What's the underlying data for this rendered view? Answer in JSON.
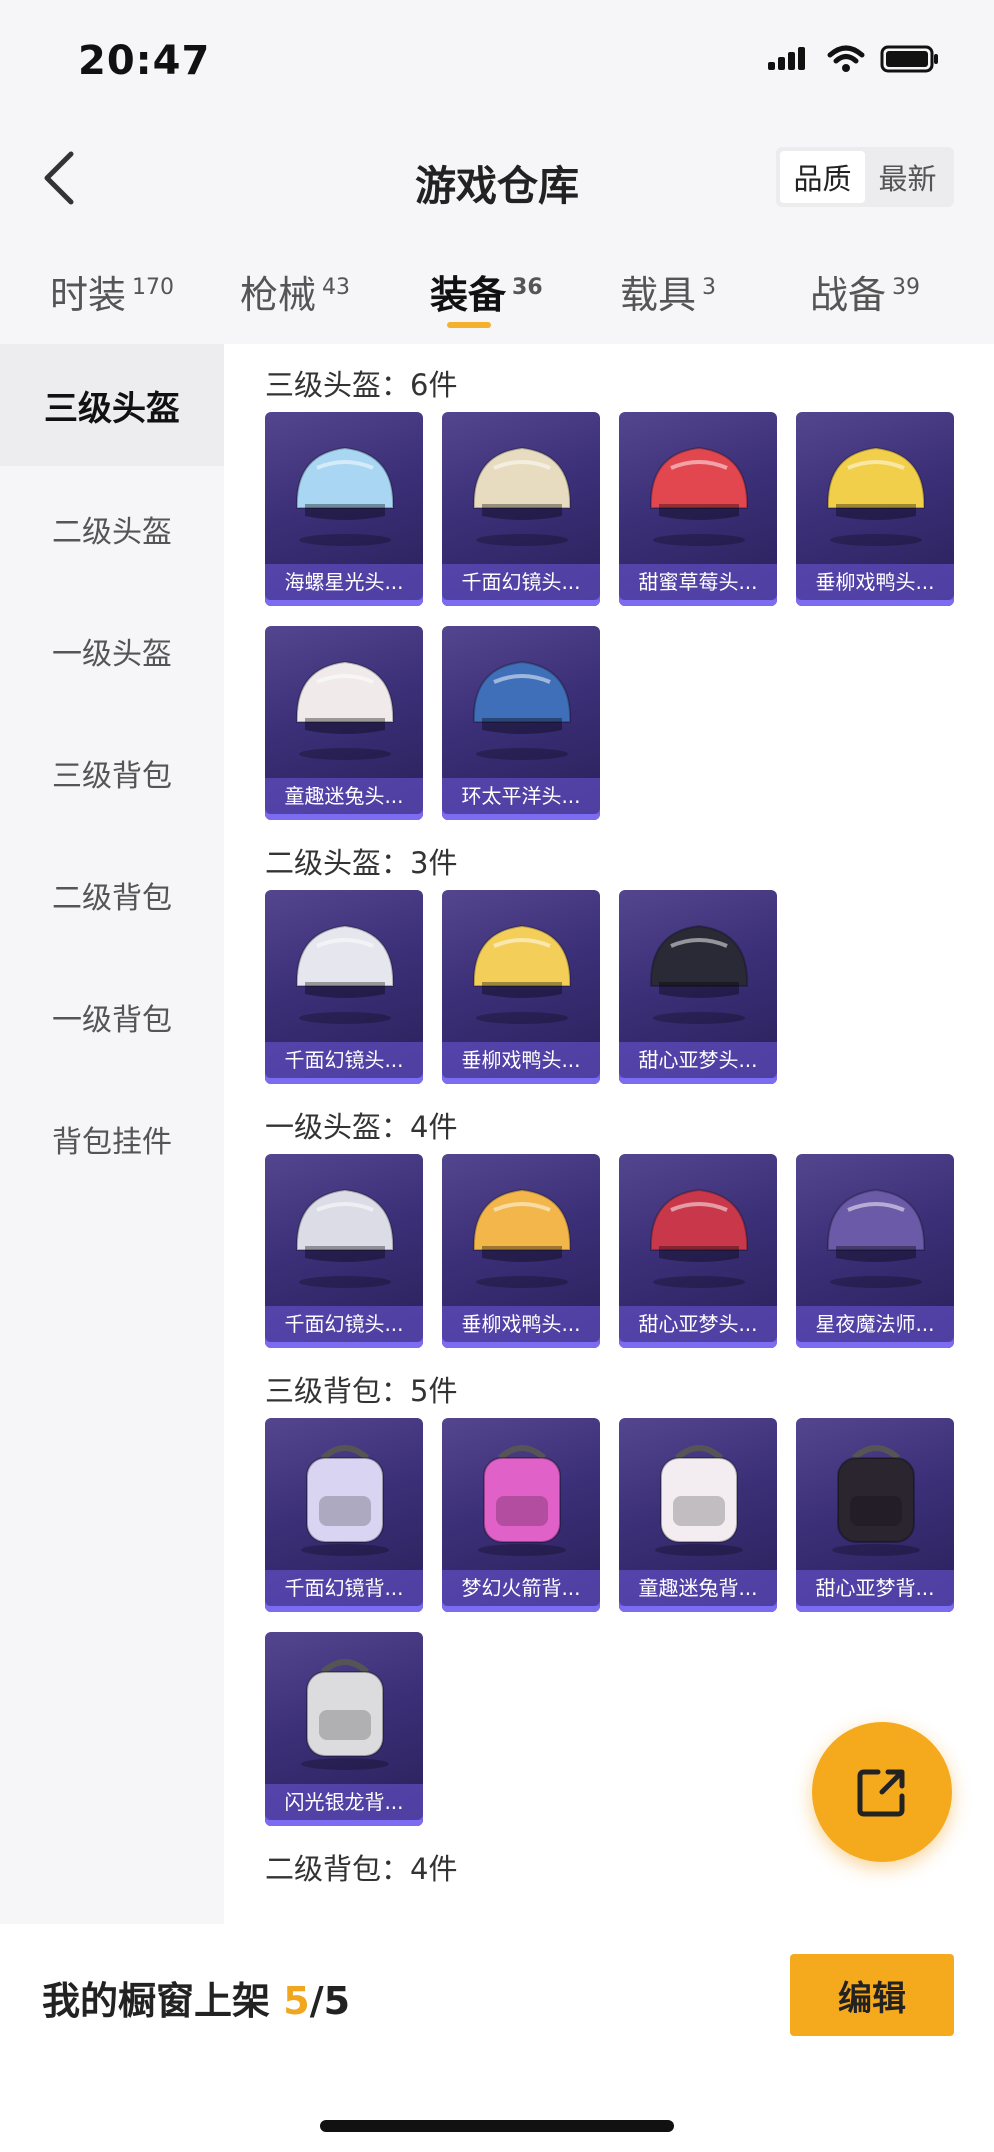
{
  "status": {
    "time": "20:47"
  },
  "header": {
    "title": "游戏仓库",
    "sort_options": [
      "品质",
      "最新"
    ],
    "sort_active": "品质"
  },
  "tabs": [
    {
      "label": "时装",
      "count": "170"
    },
    {
      "label": "枪械",
      "count": "43"
    },
    {
      "label": "装备",
      "count": "36",
      "active": true
    },
    {
      "label": "载具",
      "count": "3"
    },
    {
      "label": "战备",
      "count": "39"
    }
  ],
  "sidebar": [
    {
      "label": "三级头盔",
      "active": true
    },
    {
      "label": "二级头盔"
    },
    {
      "label": "一级头盔"
    },
    {
      "label": "三级背包"
    },
    {
      "label": "二级背包"
    },
    {
      "label": "一级背包"
    },
    {
      "label": "背包挂件"
    }
  ],
  "groups": [
    {
      "title": "三级头盔：6件",
      "items": [
        {
          "name": "海螺星光头...",
          "icon": "helmet-icon",
          "color": "#a9d6f2"
        },
        {
          "name": "千面幻镜头...",
          "icon": "helmet-icon",
          "color": "#e8dcc0"
        },
        {
          "name": "甜蜜草莓头...",
          "icon": "helmet-icon",
          "color": "#e2474f"
        },
        {
          "name": "垂柳戏鸭头...",
          "icon": "helmet-icon",
          "color": "#f2cf4a"
        },
        {
          "name": "童趣迷兔头...",
          "icon": "helmet-icon",
          "color": "#f0eaea"
        },
        {
          "name": "环太平洋头...",
          "icon": "helmet-icon",
          "color": "#3f6fb8"
        }
      ]
    },
    {
      "title": "二级头盔：3件",
      "items": [
        {
          "name": "千面幻镜头...",
          "icon": "helmet-icon",
          "color": "#e6e6ee"
        },
        {
          "name": "垂柳戏鸭头...",
          "icon": "helmet-icon",
          "color": "#f3cf5a"
        },
        {
          "name": "甜心亚梦头...",
          "icon": "helmet-icon",
          "color": "#2a2a36"
        }
      ]
    },
    {
      "title": "一级头盔：4件",
      "items": [
        {
          "name": "千面幻镜头...",
          "icon": "helmet-icon",
          "color": "#dcdce6"
        },
        {
          "name": "垂柳戏鸭头...",
          "icon": "helmet-icon",
          "color": "#f2b64a"
        },
        {
          "name": "甜心亚梦头...",
          "icon": "helmet-icon",
          "color": "#c9384a"
        },
        {
          "name": "星夜魔法师...",
          "icon": "helmet-icon",
          "color": "#6a5aa8"
        }
      ]
    },
    {
      "title": "三级背包：5件",
      "items": [
        {
          "name": "千面幻镜背...",
          "icon": "backpack-icon",
          "color": "#d9d4f2"
        },
        {
          "name": "梦幻火箭背...",
          "icon": "backpack-icon",
          "color": "#e061c8"
        },
        {
          "name": "童趣迷兔背...",
          "icon": "backpack-icon",
          "color": "#f3edf1"
        },
        {
          "name": "甜心亚梦背...",
          "icon": "backpack-icon",
          "color": "#2b2530"
        },
        {
          "name": "闪光银龙背...",
          "icon": "backpack-icon",
          "color": "#dcdcdf"
        }
      ]
    },
    {
      "title": "二级背包：4件",
      "items": []
    }
  ],
  "bottom": {
    "label": "我的橱窗上架",
    "count": "5",
    "total": "/5",
    "edit_label": "编辑"
  },
  "colors": {
    "accent": "#f5aa1e",
    "card_bg": "#3b2f78"
  }
}
